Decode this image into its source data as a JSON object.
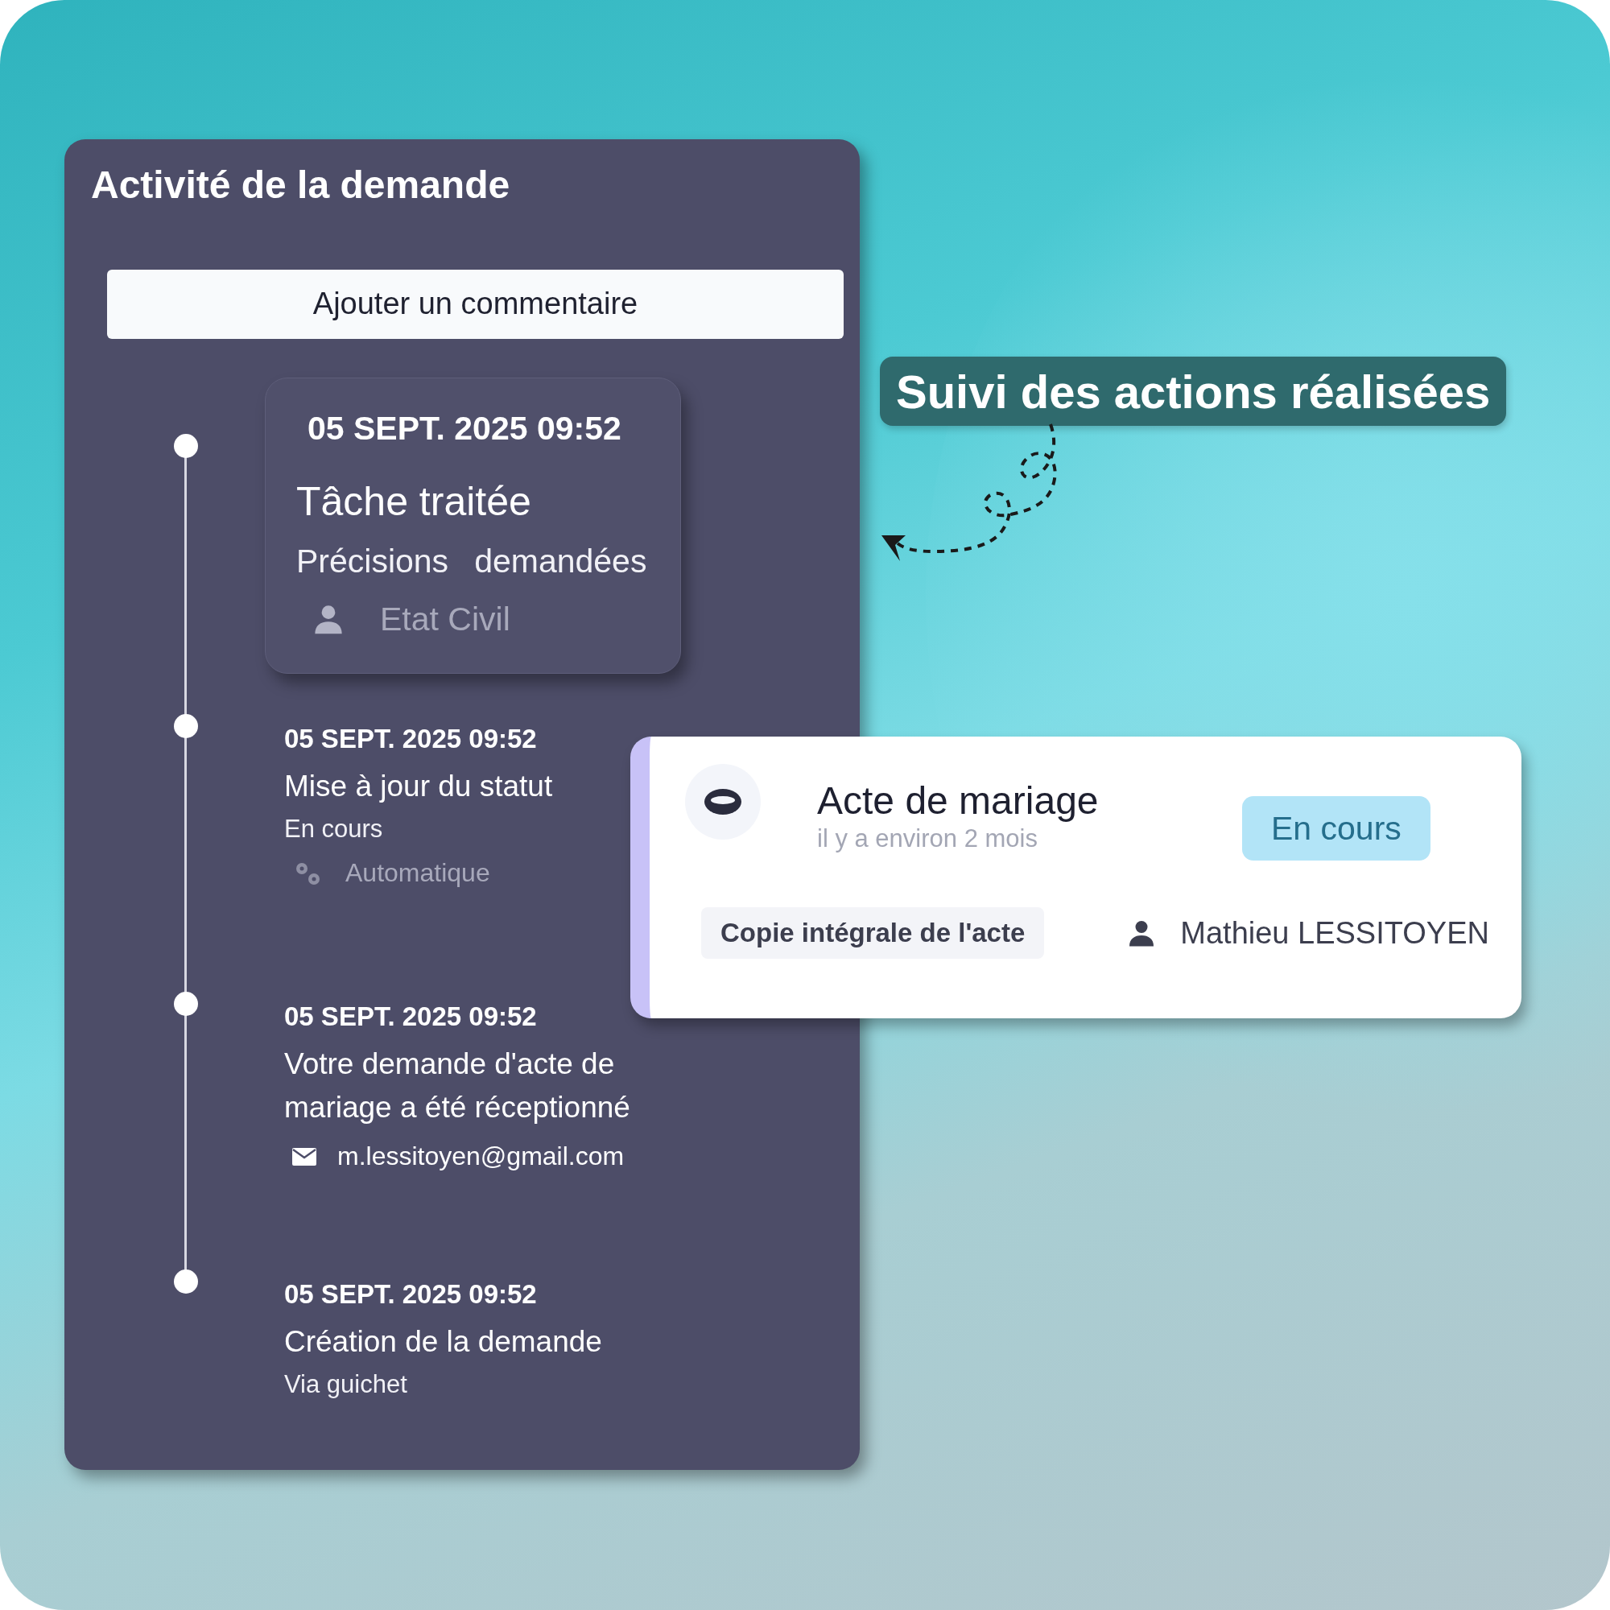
{
  "callout": {
    "text": "Suivi des actions réalisées"
  },
  "activity_panel": {
    "title": "Activité de la demande",
    "add_comment_button": "Ajouter un commentaire",
    "entries": [
      {
        "kind": "card",
        "date": "05 SEPT. 2025 09:52",
        "title": "Tâche traitée",
        "details": [
          "Précisions",
          "demandées"
        ],
        "meta": {
          "kind": "person",
          "text": "Etat Civil"
        }
      },
      {
        "kind": "plain",
        "date": "05 SEPT. 2025 09:52",
        "title": "Mise à jour du statut",
        "details": [
          "En cours"
        ],
        "meta": {
          "kind": "gears",
          "text": "Automatique"
        }
      },
      {
        "kind": "plain",
        "date": "05 SEPT. 2025 09:52",
        "title": "Votre demande d'acte de mariage a été réceptionné",
        "meta": {
          "kind": "mail",
          "text": "m.lessitoyen@gmail.com"
        }
      },
      {
        "kind": "plain",
        "date": "05 SEPT. 2025 09:52",
        "title": "Création de la demande",
        "details": [
          "Via guichet"
        ]
      }
    ]
  },
  "request_card": {
    "title": "Acte de mariage",
    "subtitle": "il y a environ 2 mois",
    "status": "En cours",
    "tag": "Copie intégrale de l'acte",
    "person": "Mathieu LESSITOYEN"
  }
}
